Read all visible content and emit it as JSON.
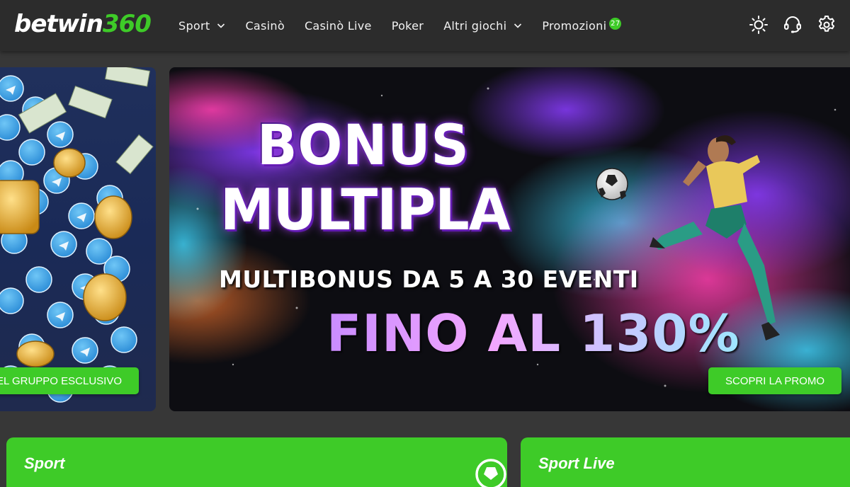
{
  "header": {
    "logo": {
      "part1": "betwin",
      "part2": "360"
    },
    "nav": [
      {
        "label": "Sport",
        "has_dropdown": true
      },
      {
        "label": "Casinò",
        "has_dropdown": false
      },
      {
        "label": "Casinò Live",
        "has_dropdown": false
      },
      {
        "label": "Poker",
        "has_dropdown": false
      },
      {
        "label": "Altri giochi",
        "has_dropdown": true
      },
      {
        "label": "Promozioni",
        "badge": "27",
        "has_dropdown": false
      }
    ],
    "icons": [
      "sun-icon",
      "headset-icon",
      "gear-icon"
    ]
  },
  "banners": {
    "left": {
      "button_label": "EL GRUPPO ESCLUSIVO"
    },
    "main": {
      "title_line1": "BONUS",
      "title_line2": "MULTIPLA",
      "subtitle": "MULTIBONUS DA 5 A 30 EVENTI",
      "highlight": "FINO AL 130%",
      "button_label": "SCOPRI LA PROMO"
    }
  },
  "cards": [
    {
      "title": "Sport"
    },
    {
      "title": "Sport Live"
    }
  ],
  "colors": {
    "accent": "#3ecb28",
    "header_bg": "#2c2c2c",
    "page_bg": "#373737"
  }
}
